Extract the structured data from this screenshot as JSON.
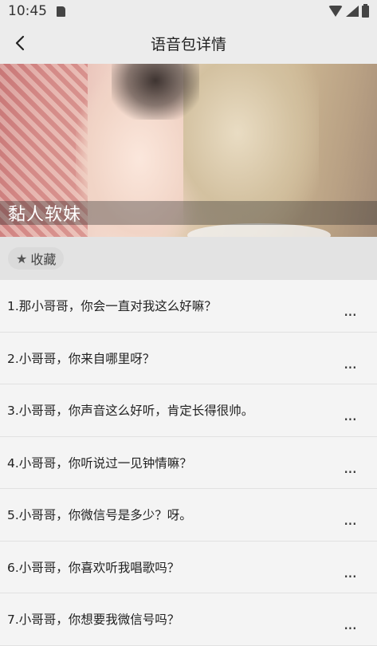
{
  "status_bar": {
    "time": "10:45",
    "icons": [
      "sd-card-icon",
      "wifi-icon",
      "signal-icon",
      "battery-icon"
    ]
  },
  "nav": {
    "back_icon": "chevron-left-icon",
    "title": "语音包详情"
  },
  "hero": {
    "caption": "黏人软妹"
  },
  "favorite": {
    "icon": "star-icon",
    "label": "收藏"
  },
  "items": [
    {
      "text": "1.那小哥哥，你会一直对我这么好嘛？",
      "more": "..."
    },
    {
      "text": "2.小哥哥，你来自哪里呀？",
      "more": "..."
    },
    {
      "text": "3.小哥哥，你声音这么好听，肯定长得很帅。",
      "more": "..."
    },
    {
      "text": "4.小哥哥，你听说过一见钟情嘛？",
      "more": "..."
    },
    {
      "text": "5.小哥哥，你微信号是多少？呀。",
      "more": "..."
    },
    {
      "text": "6.小哥哥，你喜欢听我唱歌吗？",
      "more": "..."
    },
    {
      "text": "7.小哥哥，你想要我微信号吗？",
      "more": "..."
    }
  ]
}
